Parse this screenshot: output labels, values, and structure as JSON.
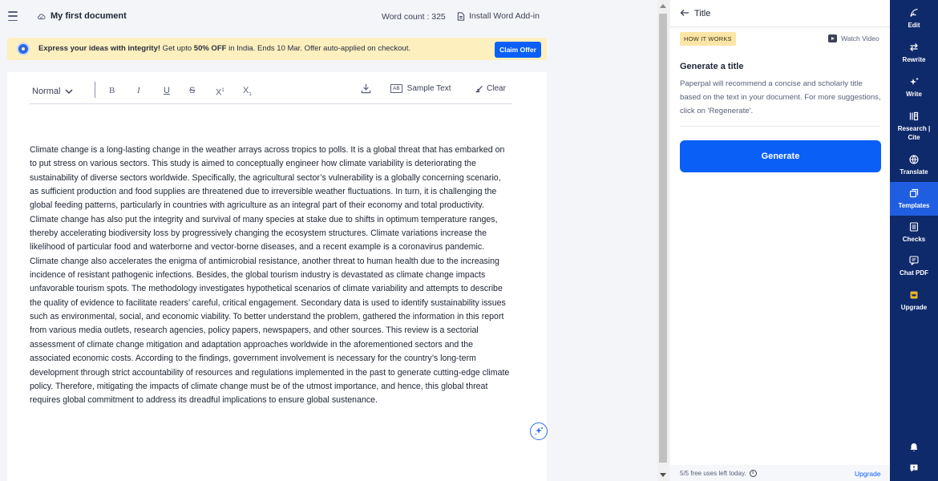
{
  "topbar": {
    "doc_title": "My first document",
    "word_count": "Word count : 325",
    "install_addin": "Install Word Add-in"
  },
  "promo": {
    "lead": "Express your ideas with integrity!",
    "mid": " Get upto ",
    "discount": "50% OFF",
    "tail": " in India. Ends 10 Mar. Offer auto-applied on checkout.",
    "claim_label": "Claim Offer"
  },
  "toolbar": {
    "style": "Normal",
    "bold": "B",
    "italic": "I",
    "underline": "U",
    "strike": "S",
    "superscript": "X",
    "superscript_mark": "1",
    "subscript": "X",
    "subscript_mark": "1",
    "sample_badge": "AB",
    "sample_text": "Sample Text",
    "clear": "Clear"
  },
  "document": {
    "body": "Climate change is a long-lasting change in the weather arrays across tropics to polls. It is a global threat that has embarked on to put stress on various sectors. This study is aimed to conceptually engineer how climate variability is deteriorating the sustainability of diverse sectors worldwide. Specifically, the agricultural sector’s vulnerability is a globally concerning scenario, as sufficient production and food supplies are threatened due to irreversible weather fluctuations. In turn, it is challenging the global feeding patterns, particularly in countries with agriculture as an integral part of their economy and total productivity. Climate change has also put the integrity and survival of many species at stake due to shifts in optimum temperature ranges, thereby accelerating biodiversity loss by progressively changing the ecosystem structures. Climate variations increase the likelihood of particular food and waterborne and vector-borne diseases, and a recent example is a coronavirus pandemic. Climate change also accelerates the enigma of antimicrobial resistance, another threat to human health due to the increasing incidence of resistant pathogenic infections. Besides, the global tourism industry is devastated as climate change impacts unfavorable tourism spots. The methodology investigates hypothetical scenarios of climate variability and attempts to describe the quality of evidence to facilitate readers’ careful, critical engagement. Secondary data is used to identify sustainability issues such as environmental, social, and economic viability. To better understand the problem, gathered the information in this report from various media outlets, research agencies, policy papers, newspapers, and other sources. This review is a sectorial assessment of climate change mitigation and adaptation approaches worldwide in the aforementioned sectors and the associated economic costs. According to the findings, government involvement is necessary for the country’s long-term development through strict accountability of resources and regulations implemented in the past to generate cutting-edge climate policy. Therefore, mitigating the impacts of climate change must be of the utmost importance, and hence, this global threat requires global commitment to address its dreadful implications to ensure global sustenance."
  },
  "panel": {
    "title": "Title",
    "how_it_works": "HOW IT WORKS",
    "watch_video": "Watch Video",
    "heading": "Generate a title",
    "description": "Paperpal will recommend a concise and scholarly title based on the text in your document. For more suggestions, click on 'Regenerate'.",
    "generate_label": "Generate",
    "uses_left": "5/5 free uses left today.",
    "upgrade": "Upgrade"
  },
  "nav": {
    "items": [
      {
        "label": "Edit",
        "icon": "feather-icon"
      },
      {
        "label": "Rewrite",
        "icon": "swap-arrows-icon"
      },
      {
        "label": "Write",
        "icon": "sparkle-icon"
      },
      {
        "label": "Research | Cite",
        "icon": "books-icon"
      },
      {
        "label": "Translate",
        "icon": "globe-icon"
      },
      {
        "label": "Templates",
        "icon": "template-icon",
        "active": true
      },
      {
        "label": "Checks",
        "icon": "checklist-icon"
      },
      {
        "label": "Chat PDF",
        "icon": "chat-icon"
      },
      {
        "label": "Upgrade",
        "icon": "crown-icon"
      }
    ]
  },
  "colors": {
    "accent": "#0a5ff7",
    "nav_bg": "#0e2a6b",
    "nav_active": "#1f5ee0",
    "promo_bg": "#fdefbe",
    "badge_bg": "#fbe6a7"
  }
}
